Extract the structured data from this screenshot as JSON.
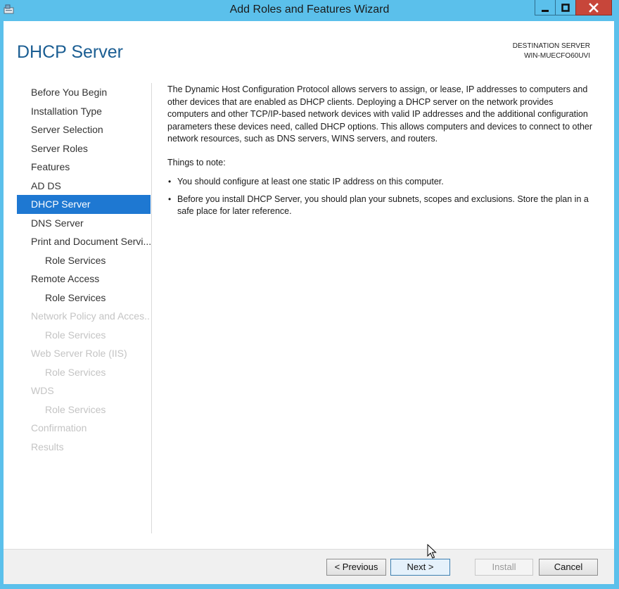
{
  "window": {
    "title": "Add Roles and Features Wizard",
    "icon": "server-manager-icon",
    "controls": {
      "minimize": "minimize-icon",
      "maximize": "maximize-icon",
      "close": "close-icon"
    }
  },
  "header": {
    "page_title": "DHCP Server",
    "destination_label": "DESTINATION SERVER",
    "destination_server": "WIN-MUECFO60UVI"
  },
  "nav": {
    "items": [
      {
        "label": "Before You Begin",
        "state": "normal"
      },
      {
        "label": "Installation Type",
        "state": "normal"
      },
      {
        "label": "Server Selection",
        "state": "normal"
      },
      {
        "label": "Server Roles",
        "state": "normal"
      },
      {
        "label": "Features",
        "state": "normal"
      },
      {
        "label": "AD DS",
        "state": "normal"
      },
      {
        "label": "DHCP Server",
        "state": "active"
      },
      {
        "label": "DNS Server",
        "state": "normal"
      },
      {
        "label": "Print and Document Servi...",
        "state": "normal"
      },
      {
        "label": "Role Services",
        "state": "normal",
        "sub": true
      },
      {
        "label": "Remote Access",
        "state": "normal"
      },
      {
        "label": "Role Services",
        "state": "normal",
        "sub": true
      },
      {
        "label": "Network Policy and Acces...",
        "state": "disabled"
      },
      {
        "label": "Role Services",
        "state": "disabled",
        "sub": true
      },
      {
        "label": "Web Server Role (IIS)",
        "state": "disabled"
      },
      {
        "label": "Role Services",
        "state": "disabled",
        "sub": true
      },
      {
        "label": "WDS",
        "state": "disabled"
      },
      {
        "label": "Role Services",
        "state": "disabled",
        "sub": true
      },
      {
        "label": "Confirmation",
        "state": "disabled"
      },
      {
        "label": "Results",
        "state": "disabled"
      }
    ]
  },
  "main": {
    "description": "The Dynamic Host Configuration Protocol allows servers to assign, or lease, IP addresses to computers and other devices that are enabled as DHCP clients. Deploying a DHCP server on the network provides computers and other TCP/IP-based network devices with valid IP addresses and the additional configuration parameters these devices need, called DHCP options. This allows computers and devices to connect to other network resources, such as DNS servers, WINS servers, and routers.",
    "notes_title": "Things to note:",
    "notes": [
      "You should configure at least one static IP address on this computer.",
      "Before you install DHCP Server, you should plan your subnets, scopes and exclusions. Store the plan in a safe place for later reference."
    ]
  },
  "footer": {
    "previous_label": "< Previous",
    "next_label": "Next >",
    "install_label": "Install",
    "cancel_label": "Cancel"
  },
  "colors": {
    "title_bar": "#5bc0eb",
    "accent": "#1e78d2",
    "page_title": "#1b5e93",
    "close_button": "#c7463a"
  }
}
